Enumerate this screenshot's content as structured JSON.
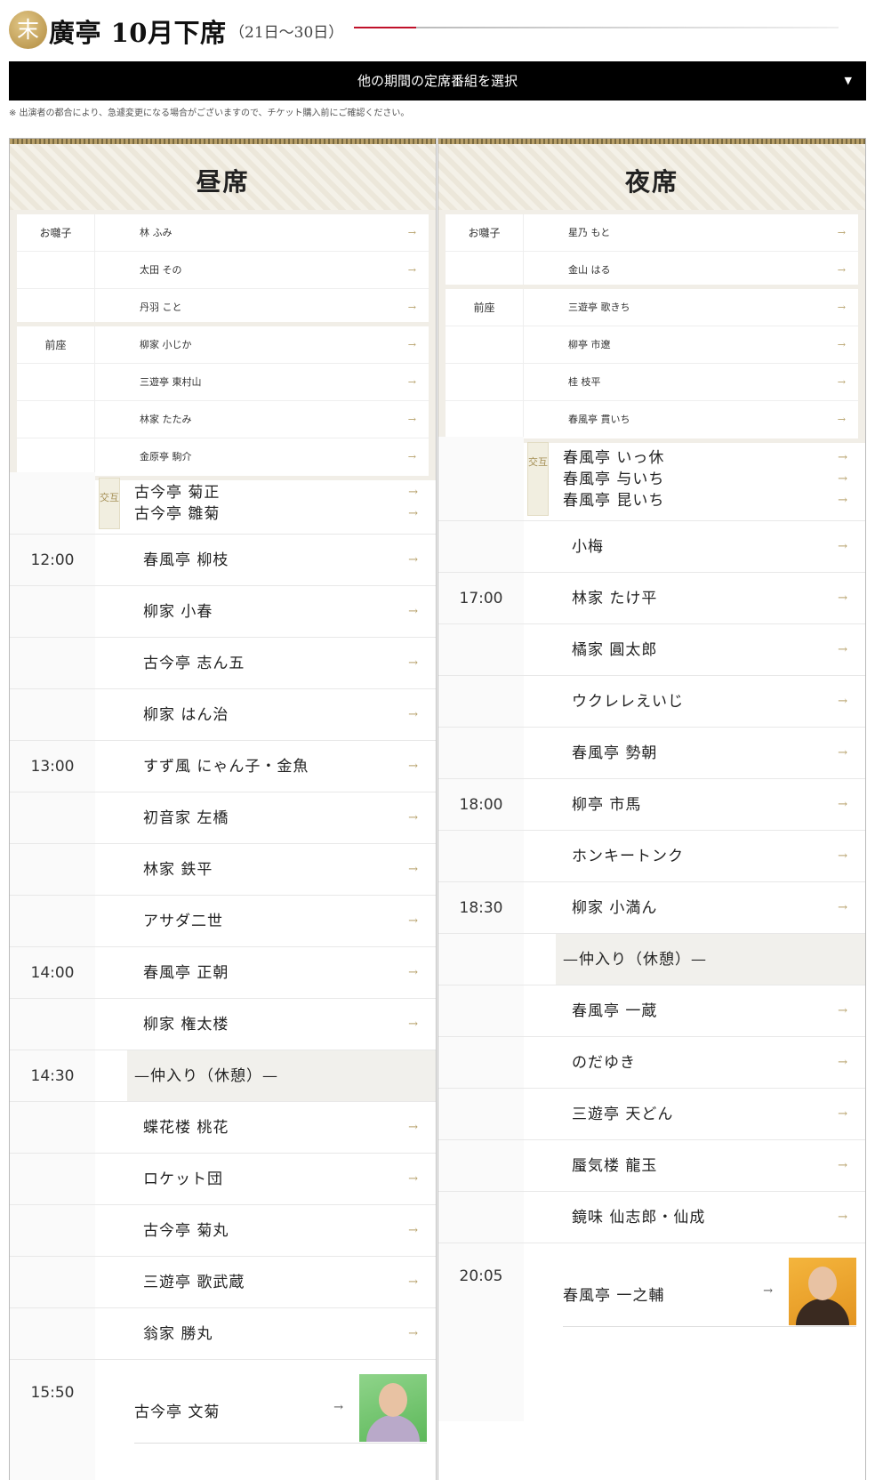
{
  "header": {
    "badge": "末",
    "title": "廣亭 10月下席",
    "dates": "（21日〜30日）",
    "period_select": "他の期間の定席番組を選択",
    "note": "※ 出演者の都合により、急遽変更になる場合がございますので、チケット購入前にご確認ください。"
  },
  "day": {
    "title": "昼席",
    "hayashi_label": "お囃子",
    "hayashi": [
      "林 ふみ",
      "太田 その",
      "丹羽 こと"
    ],
    "zenza_label": "前座",
    "zenza": [
      "柳家 小じか",
      "三遊亭 東村山",
      "林家 たたみ",
      "金原亭 駒介"
    ],
    "alternate": {
      "tag": "交互",
      "names": [
        "古今亭 菊正",
        "古今亭 雛菊"
      ]
    },
    "rows": [
      {
        "time": "12:00",
        "name": "春風亭 柳枝"
      },
      {
        "time": "",
        "name": "柳家 小春"
      },
      {
        "time": "",
        "name": "古今亭 志ん五"
      },
      {
        "time": "",
        "name": "柳家 はん治"
      },
      {
        "time": "13:00",
        "name": "すず風 にゃん子・金魚"
      },
      {
        "time": "",
        "name": "初音家 左橋"
      },
      {
        "time": "",
        "name": "林家 鉄平"
      },
      {
        "time": "",
        "name": "アサダ二世"
      },
      {
        "time": "14:00",
        "name": "春風亭 正朝"
      },
      {
        "time": "",
        "name": "柳家 権太楼"
      },
      {
        "time": "14:30",
        "name": "—仲入り（休憩）—",
        "intermission": true
      },
      {
        "time": "",
        "name": "蝶花楼 桃花"
      },
      {
        "time": "",
        "name": "ロケット団"
      },
      {
        "time": "",
        "name": "古今亭 菊丸"
      },
      {
        "time": "",
        "name": "三遊亭 歌武蔵"
      },
      {
        "time": "",
        "name": "翁家 勝丸"
      }
    ],
    "closer": {
      "time": "15:50",
      "name": "古今亭 文菊"
    }
  },
  "night": {
    "title": "夜席",
    "hayashi_label": "お囃子",
    "hayashi": [
      "星乃 もと",
      "金山 はる"
    ],
    "zenza_label": "前座",
    "zenza": [
      "三遊亭 歌きち",
      "柳亭 市遼",
      "桂 枝平",
      "春風亭 貫いち"
    ],
    "alternate": {
      "tag": "交互",
      "names": [
        "春風亭 いっ休",
        "春風亭 与いち",
        "春風亭 昆いち"
      ]
    },
    "rows": [
      {
        "time": "",
        "name": "小梅"
      },
      {
        "time": "17:00",
        "name": "林家 たけ平"
      },
      {
        "time": "",
        "name": "橘家 圓太郎"
      },
      {
        "time": "",
        "name": "ウクレレえいじ"
      },
      {
        "time": "",
        "name": "春風亭 勢朝"
      },
      {
        "time": "18:00",
        "name": "柳亭 市馬"
      },
      {
        "time": "",
        "name": "ホンキートンク"
      },
      {
        "time": "18:30",
        "name": "柳家 小満ん"
      },
      {
        "time": "",
        "name": "—仲入り（休憩）—",
        "intermission": true
      },
      {
        "time": "",
        "name": "春風亭 一蔵"
      },
      {
        "time": "",
        "name": "のだゆき"
      },
      {
        "time": "",
        "name": "三遊亭 天どん"
      },
      {
        "time": "",
        "name": "蜃気楼 龍玉"
      },
      {
        "time": "",
        "name": "鏡味 仙志郎・仙成"
      }
    ],
    "closer": {
      "time": "20:05",
      "name": "春風亭 一之輔"
    }
  },
  "arrow_glyph": "→"
}
